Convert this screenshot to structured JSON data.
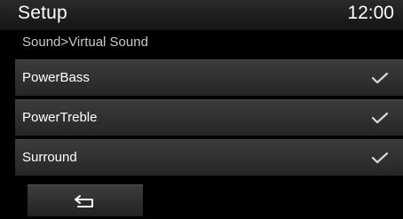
{
  "header": {
    "title": "Setup",
    "clock": "12:00"
  },
  "breadcrumb": "Sound>Virtual Sound",
  "items": [
    {
      "label": "PowerBass",
      "checked": true,
      "icon": "checkmark-icon"
    },
    {
      "label": "PowerTreble",
      "checked": true,
      "icon": "checkmark-icon"
    },
    {
      "label": "Surround",
      "checked": true,
      "icon": "checkmark-icon"
    }
  ],
  "footer": {
    "back_icon": "back-arrow-icon"
  },
  "colors": {
    "background": "#000000",
    "item_top": "#3b3b3b",
    "item_bottom": "#262626",
    "check": "#d8d8d8"
  }
}
